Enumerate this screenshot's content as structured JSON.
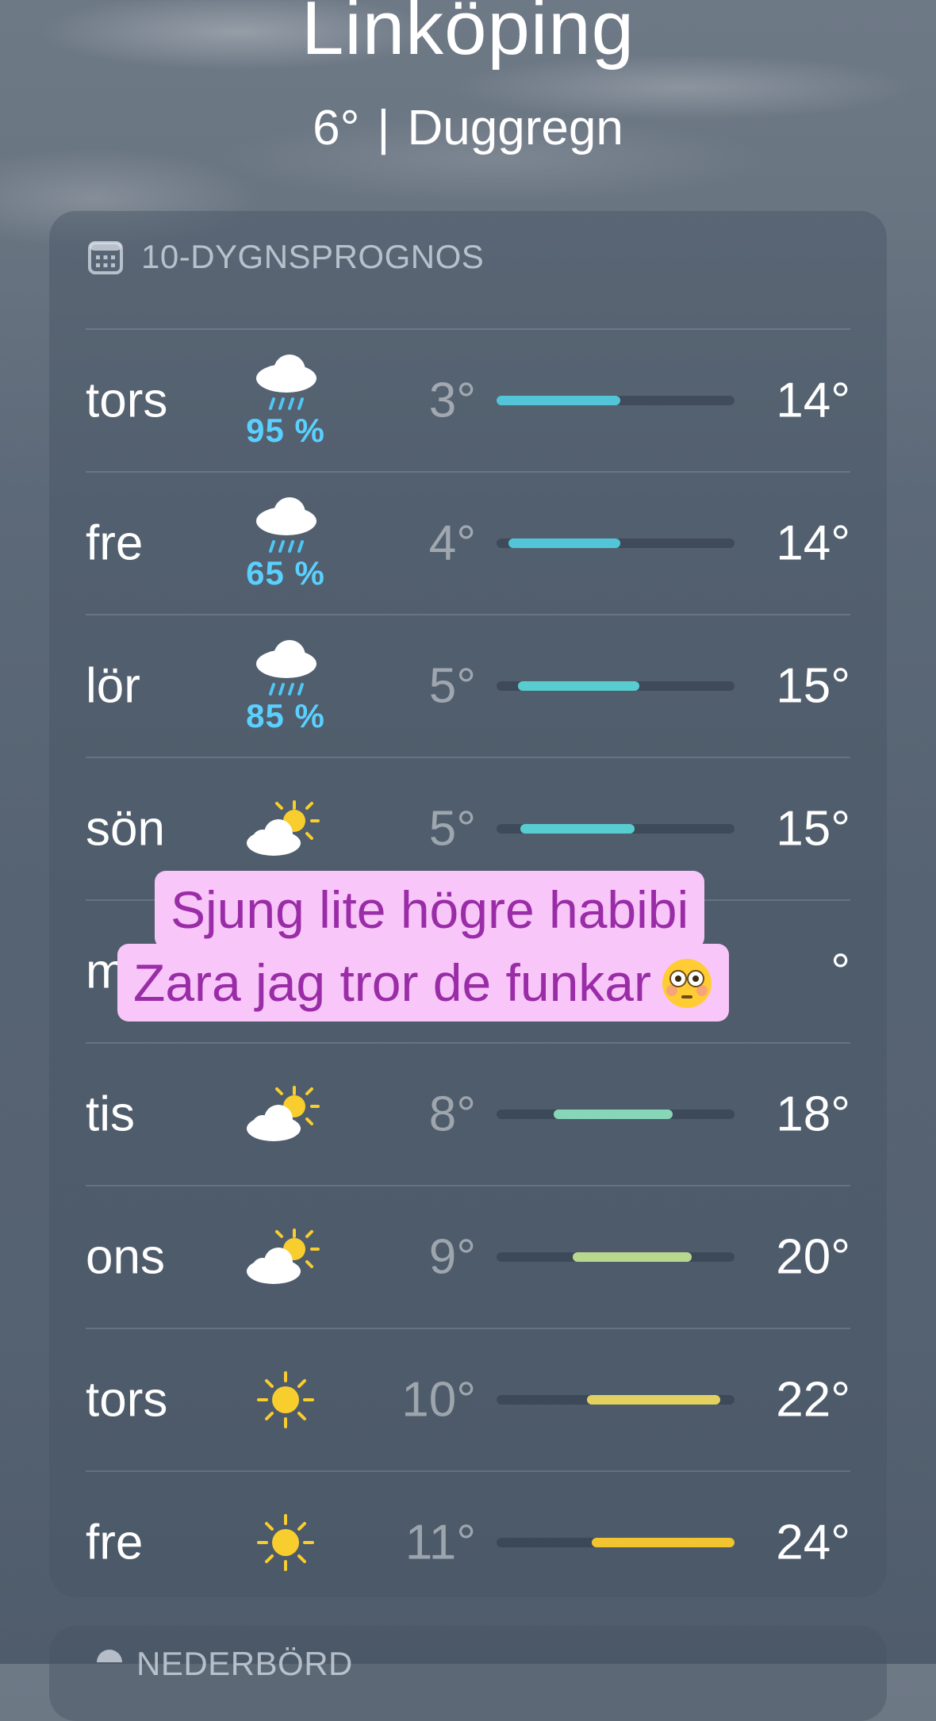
{
  "header": {
    "city": "Linköping",
    "temperature": "6°",
    "condition": "Duggregn"
  },
  "forecast": {
    "title": "10-DYGNSPROGNOS",
    "days": [
      {
        "day": "tors",
        "icon": "rain-cloud-icon",
        "precip": "95 %",
        "low": "3°",
        "high": "14°",
        "range": [
          0.0,
          0.52
        ],
        "color": "#52c6d8"
      },
      {
        "day": "fre",
        "icon": "rain-cloud-icon",
        "precip": "65 %",
        "low": "4°",
        "high": "14°",
        "range": [
          0.05,
          0.52
        ],
        "color": "#52c6d8"
      },
      {
        "day": "lör",
        "icon": "rain-cloud-icon",
        "precip": "85 %",
        "low": "5°",
        "high": "15°",
        "range": [
          0.09,
          0.6
        ],
        "color": "#58cdd0"
      },
      {
        "day": "sön",
        "icon": "partly-sunny-icon",
        "precip": "",
        "low": "5°",
        "high": "15°",
        "range": [
          0.1,
          0.58
        ],
        "color": "#58cdd0"
      },
      {
        "day": "",
        "icon": "",
        "precip": "",
        "low": "",
        "high": "",
        "range": [
          0,
          0
        ],
        "color": "#58cdd0"
      },
      {
        "day": "tis",
        "icon": "partly-sunny-icon",
        "precip": "",
        "low": "8°",
        "high": "18°",
        "range": [
          0.24,
          0.74
        ],
        "color": "#88d6b8"
      },
      {
        "day": "ons",
        "icon": "partly-sunny-icon",
        "precip": "",
        "low": "9°",
        "high": "20°",
        "range": [
          0.32,
          0.82
        ],
        "color": "#b8d890"
      },
      {
        "day": "tors",
        "icon": "sun-icon",
        "precip": "",
        "low": "10°",
        "high": "22°",
        "range": [
          0.38,
          0.94
        ],
        "color": "#e2d060"
      },
      {
        "day": "fre",
        "icon": "sun-icon",
        "precip": "",
        "low": "11°",
        "high": "24°",
        "range": [
          0.4,
          1.0
        ],
        "color": "#f2c430"
      }
    ],
    "hidden_row_high_fragment": "°",
    "hidden_row_day_fragment": "m"
  },
  "next_section": {
    "title": "NEDERBÖRD"
  },
  "caption": {
    "line1": "Sjung lite högre habibi",
    "line2": "Zara jag tror de funkar"
  },
  "icons": {
    "emoji": "flushed-face-emoji"
  }
}
